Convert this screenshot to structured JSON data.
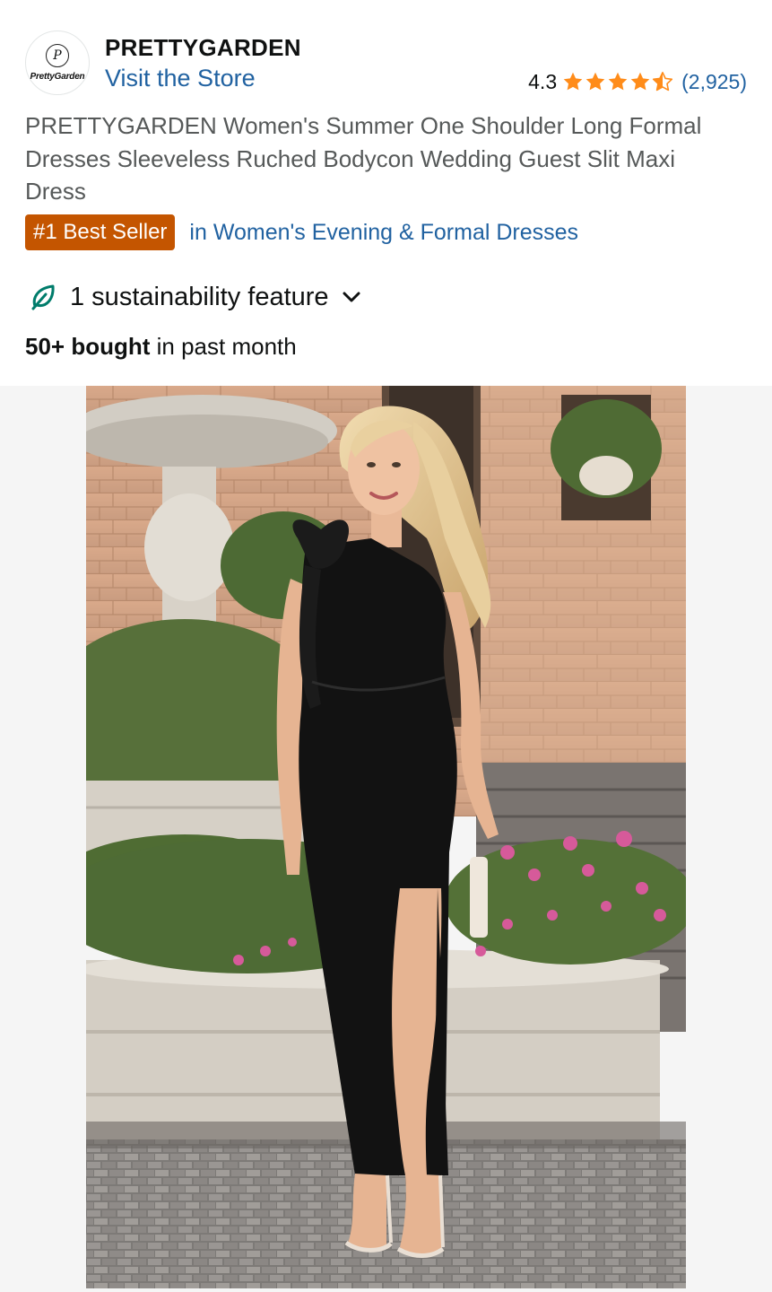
{
  "brand": {
    "name": "PRETTYGARDEN",
    "logo_text": "PrettyGarden",
    "logo_monogram": "P",
    "store_link": "Visit the Store"
  },
  "rating": {
    "score": "4.3",
    "stars_value": 4.5,
    "review_count": "(2,925)"
  },
  "product": {
    "title": "PRETTYGARDEN Women's Summer One Shoulder Long Formal Dresses Sleeveless Ruched Bodycon Wedding Guest Slit Maxi Dress"
  },
  "best_seller": {
    "badge": "#1 Best Seller",
    "category": "in Women's Evening & Formal Dresses"
  },
  "sustainability": {
    "label": "1 sustainability feature",
    "icon": "leaf-icon",
    "expand_icon": "chevron-down-icon"
  },
  "purchase": {
    "bought_bold": "50+ bought",
    "bought_rest": " in past month"
  },
  "colors": {
    "link": "#2162a1",
    "badge": "#c45500",
    "star": "#ff8c1a",
    "leaf": "#007c6b",
    "title_gray": "#565959"
  }
}
